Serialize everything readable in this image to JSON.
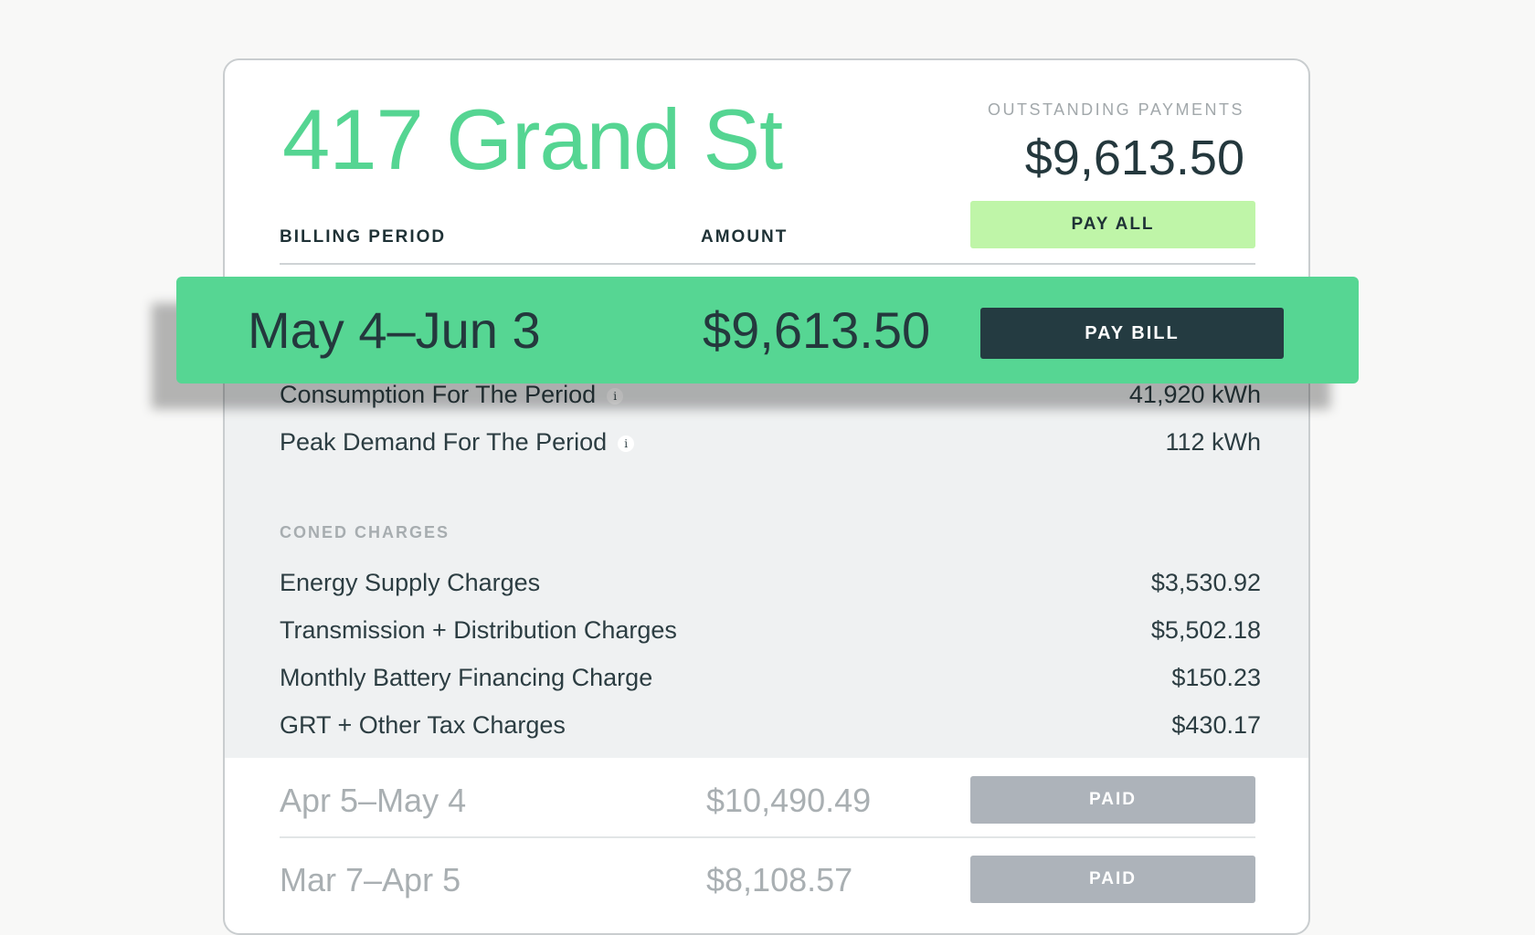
{
  "header": {
    "address": "417 Grand St",
    "outstanding_label": "OUTSTANDING PAYMENTS",
    "outstanding_amount": "$9,613.50",
    "pay_all_label": "PAY ALL"
  },
  "table": {
    "col_period": "BILLING PERIOD",
    "col_amount": "AMOUNT"
  },
  "current_bill": {
    "period": "May 4–Jun 3",
    "amount": "$9,613.50",
    "pay_label": "PAY BILL"
  },
  "details": {
    "consumption_label": "Consumption For The Period",
    "consumption_value": "41,920 kWh",
    "peak_label": "Peak Demand For The Period",
    "peak_value": "112 kWh",
    "info_glyph": "i",
    "section_label": "CONED CHARGES",
    "charges": [
      {
        "label": "Energy Supply Charges",
        "value": "$3,530.92"
      },
      {
        "label": "Transmission + Distribution Charges",
        "value": "$5,502.18"
      },
      {
        "label": "Monthly Battery Financing Charge",
        "value": "$150.23"
      },
      {
        "label": "GRT + Other Tax Charges",
        "value": "$430.17"
      }
    ]
  },
  "history": [
    {
      "period": "Apr 5–May 4",
      "amount": "$10,490.49",
      "status": "PAID"
    },
    {
      "period": "Mar 7–Apr 5",
      "amount": "$8,108.57",
      "status": "PAID"
    }
  ],
  "colors": {
    "accent_green": "#55d592",
    "banner_green": "#56d693",
    "pay_all_bg": "#bff5a8",
    "dark_button": "#243b41",
    "paid_button": "#adb3ba"
  }
}
